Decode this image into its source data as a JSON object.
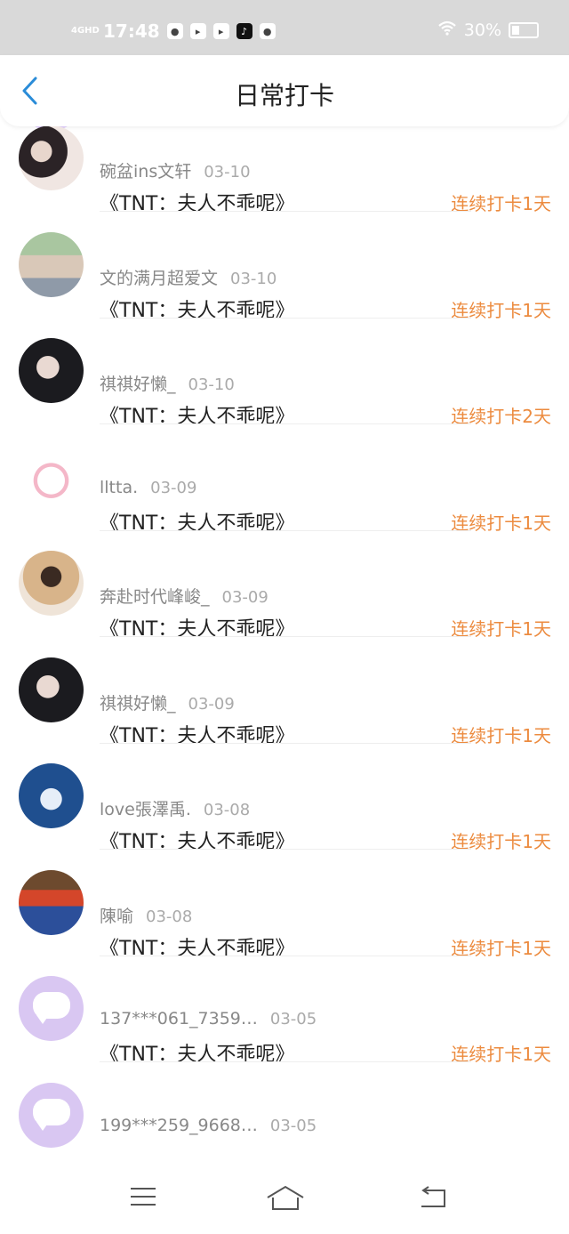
{
  "status": {
    "network": "4GHD",
    "time": "17:48",
    "battery": "30%",
    "battery_level": 0.3
  },
  "header": {
    "title": "日常打卡"
  },
  "checkins": [
    {
      "username": "碗盆ins文轩",
      "date": "03-10",
      "book": "《TNT：夫人不乖呢》",
      "streak": "连续打卡1天",
      "avatar": "photo-two-boys"
    },
    {
      "username": "文的满月超爱文",
      "date": "03-10",
      "book": "《TNT：夫人不乖呢》",
      "streak": "连续打卡1天",
      "avatar": "photo-group"
    },
    {
      "username": "祺祺好懒_",
      "date": "03-10",
      "book": "《TNT：夫人不乖呢》",
      "streak": "连续打卡2天",
      "avatar": "photo-boy"
    },
    {
      "username": "lltta.",
      "date": "03-09",
      "book": "《TNT：夫人不乖呢》",
      "streak": "连续打卡1天",
      "avatar": "hello-kitty"
    },
    {
      "username": "奔赴时代峰峻_",
      "date": "03-09",
      "book": "《TNT：夫人不乖呢》",
      "streak": "连续打卡1天",
      "avatar": "photo-girl"
    },
    {
      "username": "祺祺好懒_",
      "date": "03-09",
      "book": "《TNT：夫人不乖呢》",
      "streak": "连续打卡1天",
      "avatar": "photo-boy"
    },
    {
      "username": "love張澤禹.",
      "date": "03-08",
      "book": "《TNT：夫人不乖呢》",
      "streak": "连续打卡1天",
      "avatar": "photo-stage"
    },
    {
      "username": "陳喻",
      "date": "03-08",
      "book": "《TNT：夫人不乖呢》",
      "streak": "连续打卡1天",
      "avatar": "photo-crowd"
    },
    {
      "username": "137***061_7359…",
      "date": "03-05",
      "book": "《TNT：夫人不乖呢》",
      "streak": "连续打卡1天",
      "avatar": "default-chat"
    },
    {
      "username": "199***259_9668…",
      "date": "03-05",
      "book": "",
      "streak": "",
      "avatar": "default-chat"
    }
  ],
  "nav": {
    "menu_icon": "menu-icon",
    "home_icon": "home-icon",
    "back_icon": "back-icon"
  },
  "colors": {
    "accent": "#ec8b3f",
    "back_arrow": "#2a8cd8",
    "default_avatar": "#d9c7f2",
    "status_bar": "#d9d9d9"
  }
}
